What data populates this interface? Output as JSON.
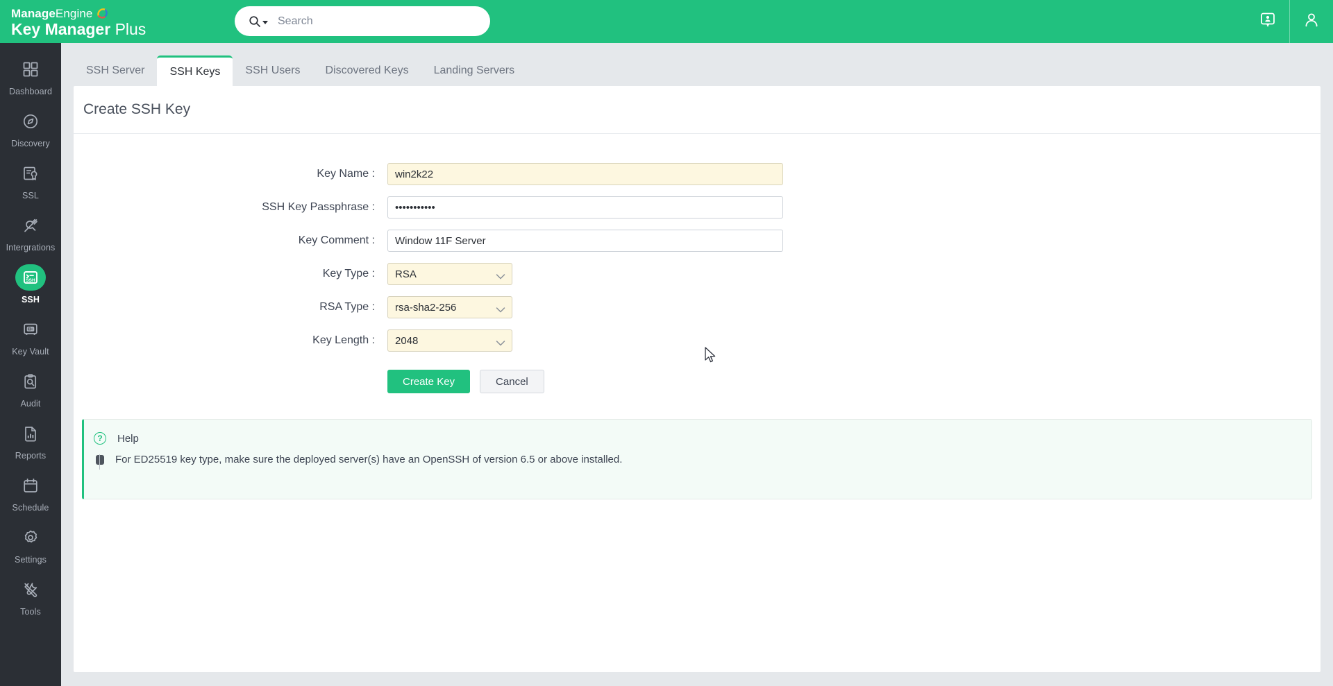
{
  "header": {
    "brand_line1_bold": "Manage",
    "brand_line1_light": "Engine",
    "brand_line2_bold": "Key Manager",
    "brand_line2_light": "Plus",
    "search_placeholder": "Search",
    "search_value": "",
    "search_icon": "search-icon",
    "chat_icon": "support-chat-icon",
    "profile_icon": "user-profile-icon",
    "brand_color": "#21c17f"
  },
  "sidebar": {
    "items": [
      {
        "label": "Dashboard",
        "icon": "grid-dashboard-icon",
        "active": false
      },
      {
        "label": "Discovery",
        "icon": "compass-icon",
        "active": false
      },
      {
        "label": "SSL",
        "icon": "certificate-icon",
        "active": false
      },
      {
        "label": "Intergrations",
        "icon": "plug-icon",
        "active": false
      },
      {
        "label": "SSH",
        "icon": "ssh-terminal-icon",
        "active": true
      },
      {
        "label": "Key Vault",
        "icon": "safe-vault-icon",
        "active": false
      },
      {
        "label": "Audit",
        "icon": "clipboard-search-icon",
        "active": false
      },
      {
        "label": "Reports",
        "icon": "report-chart-icon",
        "active": false
      },
      {
        "label": "Schedule",
        "icon": "calendar-icon",
        "active": false
      },
      {
        "label": "Settings",
        "icon": "gear-icon",
        "active": false
      },
      {
        "label": "Tools",
        "icon": "tools-wrench-icon",
        "active": false
      }
    ]
  },
  "tabs": [
    {
      "label": "SSH Server",
      "active": false
    },
    {
      "label": "SSH Keys",
      "active": true
    },
    {
      "label": "SSH Users",
      "active": false
    },
    {
      "label": "Discovered Keys",
      "active": false
    },
    {
      "label": "Landing Servers",
      "active": false
    }
  ],
  "page": {
    "title": "Create SSH Key"
  },
  "form": {
    "fields": [
      {
        "label": "Key Name :",
        "value": "win2k22",
        "type": "text",
        "autofill": true
      },
      {
        "label": "SSH Key Passphrase :",
        "value": "•••••••••••",
        "type": "password",
        "autofill": false
      },
      {
        "label": "Key Comment :",
        "value": "Window 11F Server",
        "type": "text",
        "autofill": false
      },
      {
        "label": "Key Type :",
        "value": "RSA",
        "type": "select",
        "autofill": true
      },
      {
        "label": "RSA Type :",
        "value": "rsa-sha2-256",
        "type": "select",
        "autofill": true
      },
      {
        "label": "Key Length :",
        "value": "2048",
        "type": "select",
        "autofill": true
      }
    ],
    "submit_label": "Create Key",
    "cancel_label": "Cancel"
  },
  "help": {
    "icon": "question-circle-icon",
    "title": "Help",
    "bullet_text": "For ED25519 key type, make sure the deployed server(s) have an OpenSSH of version 6.5 or above installed.",
    "accent_color": "#21c17f"
  }
}
